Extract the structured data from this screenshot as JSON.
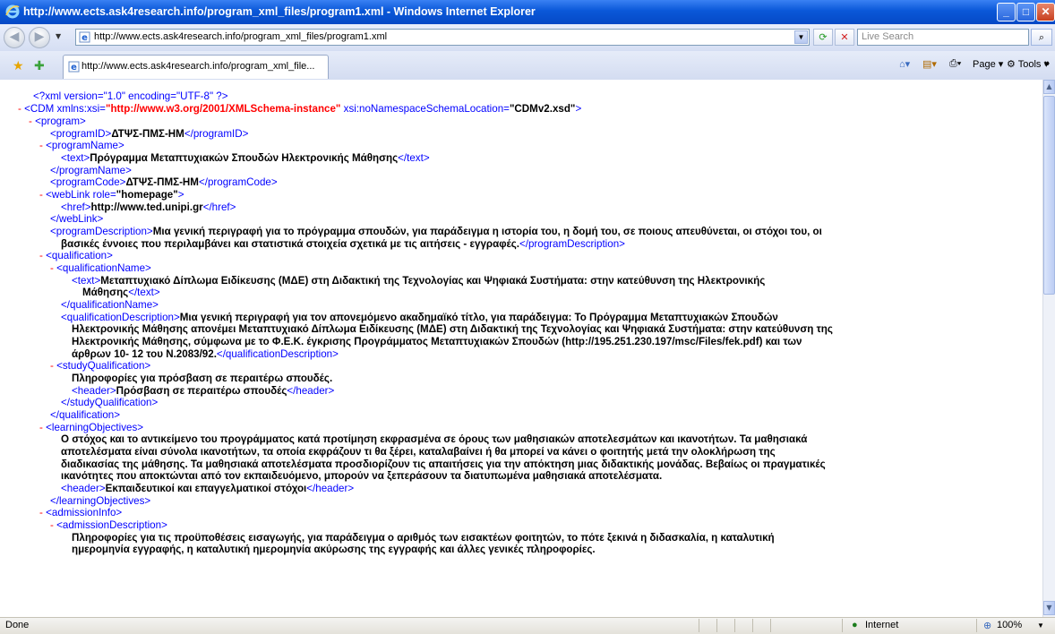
{
  "window": {
    "title": "http://www.ects.ask4research.info/program_xml_files/program1.xml - Windows Internet Explorer",
    "minimize": "_",
    "maximize": "□",
    "close": "✕"
  },
  "navbar": {
    "address": "http://www.ects.ask4research.info/program_xml_files/program1.xml",
    "search_placeholder": "Live Search"
  },
  "tab": {
    "label": "http://www.ects.ask4research.info/program_xml_file..."
  },
  "toolbar": {
    "page_label": "Page",
    "tools_label": "Tools"
  },
  "status": {
    "left": "Done",
    "zone": "Internet",
    "zoom": "100%"
  },
  "xml": {
    "pi": "<?xml version=\"1.0\" encoding=\"UTF-8\" ?>",
    "cdm_open": "<CDM xmlns:xsi=",
    "cdm_xsi_value": "\"http://www.w3.org/2001/XMLSchema-instance\"",
    "cdm_nsl_attr": " xsi:noNamespaceSchemaLocation=",
    "cdm_nsl_value": "\"CDMv2.xsd\"",
    "cdm_close_bracket": ">",
    "program_open": "<program>",
    "programID_open": "<programID>",
    "programID_value": "ΔΤΨΣ-ΠΜΣ-ΗΜ",
    "programID_close": "</programID>",
    "programName_open": "<programName>",
    "text_open": "<text>",
    "programName_text": "Πρόγραμμα Μεταπτυχιακών Σπουδών Ηλεκτρονικής Μάθησης",
    "text_close": "</text>",
    "programName_close": "</programName>",
    "programCode_open": "<programCode>",
    "programCode_value": "ΔΤΨΣ-ΠΜΣ-ΗΜ",
    "programCode_close": "</programCode>",
    "webLink_open": "<webLink role=",
    "webLink_role": "\"homepage\"",
    "href_open": "<href>",
    "href_value": "http://www.ted.unipi.gr",
    "href_close": "</href>",
    "webLink_close": "</webLink>",
    "programDescription_open": "<programDescription>",
    "programDescription_1": "Μια γενική περιγραφή για το πρόγραμμα σπουδών, για παράδειγμα η ιστορία του, η δομή του, σε ποιους απευθύνεται, οι στόχοι του, οι",
    "programDescription_2": "βασικές έννοιες που περιλαμβάνει και στατιστικά στοιχεία σχετικά με τις αιτήσεις - εγγραφές.",
    "programDescription_close": "</programDescription>",
    "qualification_open": "<qualification>",
    "qualificationName_open": "<qualificationName>",
    "qualificationName_text_1": "Μεταπτυχιακό Δίπλωμα Ειδίκευσης (ΜΔΕ) στη Διδακτική της Τεχνολογίας και Ψηφιακά Συστήματα: στην κατεύθυνση της Ηλεκτρονικής",
    "qualificationName_text_2": "Μάθησης",
    "qualificationName_close": "</qualificationName>",
    "qualificationDescription_open": "<qualificationDescription>",
    "qualificationDescription_1": "Μια γενική περιγραφή για τον απονεμόμενο ακαδημαϊκό τίτλο, για παράδειγμα: Το Πρόγραμμα Μεταπτυχιακών Σπουδών",
    "qualificationDescription_2": "Ηλεκτρονικής Μάθησης απονέμει Μεταπτυχιακό Δίπλωμα Ειδίκευσης (ΜΔΕ) στη Διδακτική της Τεχνολογίας και Ψηφιακά Συστήματα: στην κατεύθυνση της",
    "qualificationDescription_3": "Ηλεκτρονικής Μάθησης, σύμφωνα με το Φ.Ε.Κ. έγκρισης Προγράμματος Μεταπτυχιακών Σπουδών (http://195.251.230.197/msc/Files/fek.pdf) και των",
    "qualificationDescription_4": "άρθρων 10- 12 του Ν.2083/92.",
    "qualificationDescription_close": "</qualificationDescription>",
    "studyQualification_open": "<studyQualification>",
    "studyQualification_text": "Πληροφορίες για πρόσβαση σε περαιτέρω σπουδές.",
    "header_open": "<header>",
    "studyQualification_header": "Πρόσβαση σε περαιτέρω σπουδές",
    "header_close": "</header>",
    "studyQualification_close": "</studyQualification>",
    "qualification_close": "</qualification>",
    "learningObjectives_open": "<learningObjectives>",
    "learningObjectives_1": "Ο στόχος και το αντικείμενο του προγράμματος κατά προτίμηση εκφρασμένα σε όρους των μαθησιακών αποτελεσμάτων και ικανοτήτων. Τα μαθησιακά",
    "learningObjectives_2": "αποτελέσματα είναι σύνολα ικανοτήτων, τα οποία εκφράζουν τι θα ξέρει, καταλαβαίνει ή θα μπορεί να κάνει ο φοιτητής μετά την ολοκλήρωση της",
    "learningObjectives_3": "διαδικασίας της μάθησης. Τα μαθησιακά αποτελέσματα προσδιορίζουν τις απαιτήσεις για την απόκτηση μιας διδακτικής μονάδας. Βεβαίως οι πραγματικές",
    "learningObjectives_4": "ικανότητες που αποκτώνται από τον εκπαιδευόμενο, μπορούν να ξεπεράσουν τα διατυπωμένα μαθησιακά αποτελέσματα.",
    "learningObjectives_header": "Εκπαιδευτικοί και επαγγελματικοί στόχοι",
    "learningObjectives_close": "</learningObjectives>",
    "admissionInfo_open": "<admissionInfo>",
    "admissionDescription_open": "<admissionDescription>",
    "admissionDescription_1": "Πληροφορίες για τις προϋποθέσεις εισαγωγής, για παράδειγμα ο αριθμός των εισακτέων φοιτητών, το πότε ξεκινά η διδασκαλία, η καταλυτική",
    "admissionDescription_2": "ημερομηνία εγγραφής, η καταλυτική ημερομηνία ακύρωσης της εγγραφής και άλλες γενικές πληροφορίες.",
    "minus": "-"
  }
}
